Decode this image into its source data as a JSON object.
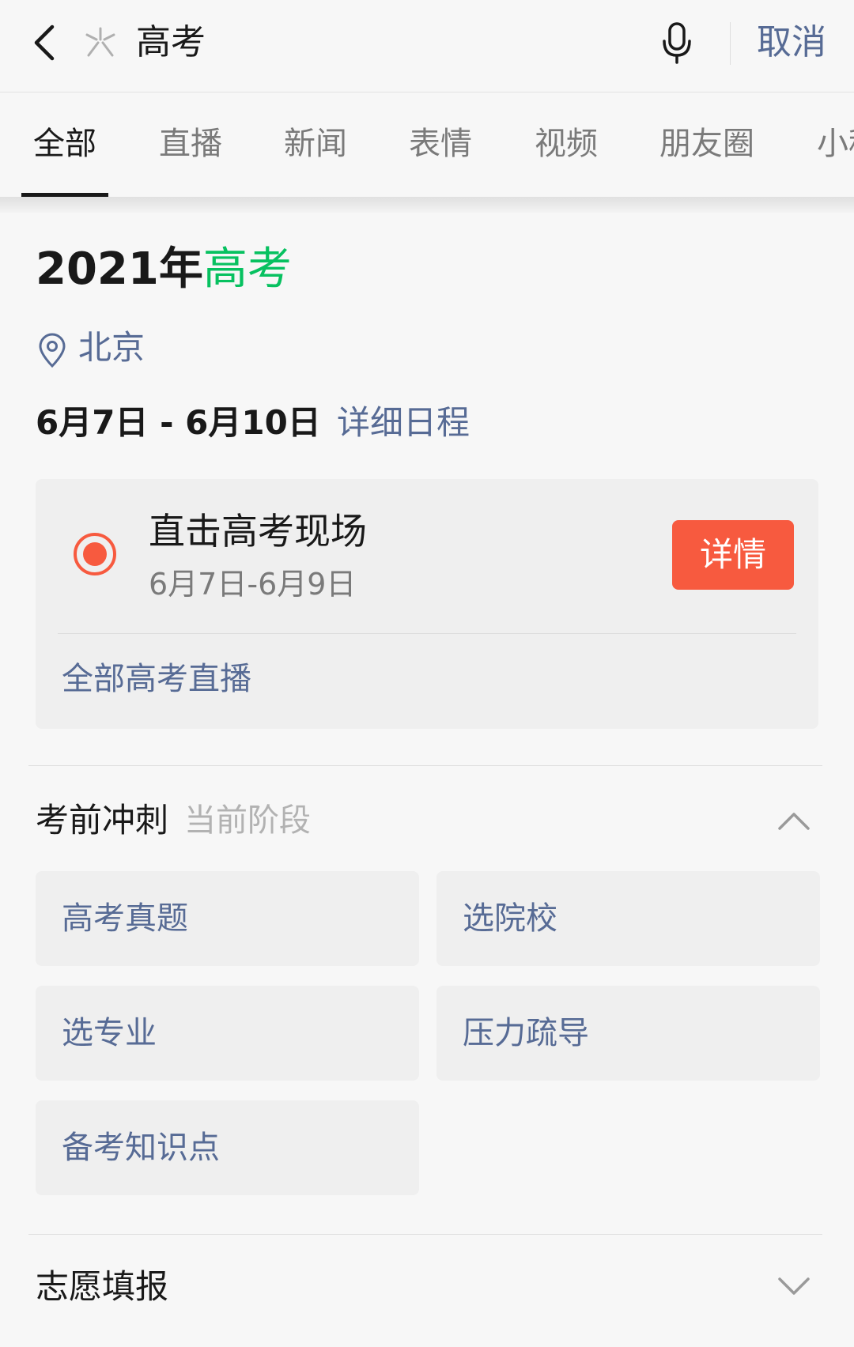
{
  "header": {
    "search_query": "高考",
    "cancel_label": "取消"
  },
  "tabs": [
    {
      "label": "全部",
      "active": true
    },
    {
      "label": "直播"
    },
    {
      "label": "新闻"
    },
    {
      "label": "表情"
    },
    {
      "label": "视频"
    },
    {
      "label": "朋友圈"
    },
    {
      "label": "小程"
    }
  ],
  "event": {
    "year": "2021年",
    "keyword": "高考",
    "location": "北京",
    "dates": "6月7日 - 6月10日",
    "schedule_link": "详细日程"
  },
  "live": {
    "title": "直击高考现场",
    "dates": "6月7日-6月9日",
    "detail_label": "详情",
    "all_live_label": "全部高考直播"
  },
  "sprint": {
    "title": "考前冲刺",
    "stage": "当前阶段",
    "items": [
      "高考真题",
      "选院校",
      "选专业",
      "压力疏导",
      "备考知识点"
    ]
  },
  "application": {
    "title": "志愿填报"
  },
  "colors": {
    "accent_green": "#07c160",
    "link_blue": "#576b95",
    "live_red": "#f75a3f"
  }
}
